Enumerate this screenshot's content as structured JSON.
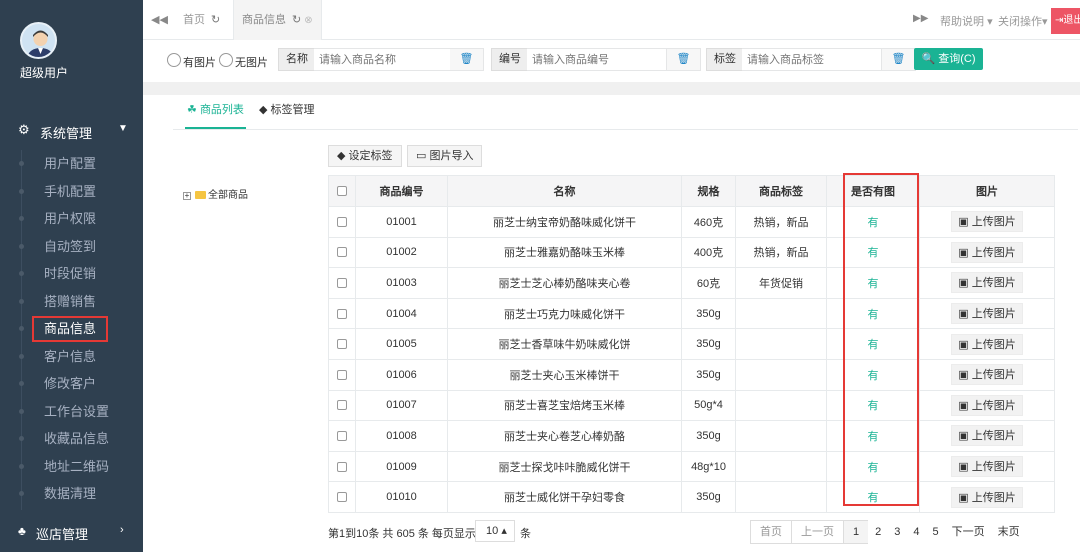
{
  "sidebar": {
    "user_name": "超级用户",
    "menu_title": "系统管理",
    "items": [
      {
        "label": "用户配置"
      },
      {
        "label": "手机配置"
      },
      {
        "label": "用户权限"
      },
      {
        "label": "自动签到"
      },
      {
        "label": "时段促销"
      },
      {
        "label": "搭赠销售"
      },
      {
        "label": "商品信息"
      },
      {
        "label": "客户信息"
      },
      {
        "label": "修改客户"
      },
      {
        "label": "工作台设置"
      },
      {
        "label": "收藏品信息"
      },
      {
        "label": "地址二维码"
      },
      {
        "label": "数据清理"
      }
    ],
    "active_item": "商品信息",
    "shop_menu": "巡店管理"
  },
  "tabs": {
    "home": "首页",
    "goods": "商品信息",
    "help": "帮助说明",
    "close_ops": "关闭操作",
    "logout": "退出"
  },
  "filters": {
    "with_pic": "有图片",
    "without_pic": "无图片",
    "name_label": "名称",
    "name_placeholder": "请输入商品名称",
    "code_label": "编号",
    "code_placeholder": "请输入商品编号",
    "tag_label": "标签",
    "tag_placeholder": "请输入商品标签",
    "query_button": "查询(C)"
  },
  "content_tabs": {
    "list": "商品列表",
    "tags": "标签管理"
  },
  "toolbar": {
    "set_tag": "设定标签",
    "import_pic": "图片导入"
  },
  "tree": {
    "root": "全部商品"
  },
  "table": {
    "columns": [
      "商品编号",
      "名称",
      "规格",
      "商品标签",
      "是否有图",
      "图片"
    ],
    "upload_label": "上传图片",
    "rows": [
      {
        "code": "01001",
        "name": "丽芝士纳宝帝奶酪味威化饼干",
        "spec": "460克",
        "tag": "热销，新品",
        "has_pic": "有"
      },
      {
        "code": "01002",
        "name": "丽芝士雅嘉奶酪味玉米棒",
        "spec": "400克",
        "tag": "热销，新品",
        "has_pic": "有"
      },
      {
        "code": "01003",
        "name": "丽芝士芝心棒奶酪味夹心卷",
        "spec": "60克",
        "tag": "年货促销",
        "has_pic": "有"
      },
      {
        "code": "01004",
        "name": "丽芝士巧克力味威化饼干",
        "spec": "350g",
        "tag": "",
        "has_pic": "有"
      },
      {
        "code": "01005",
        "name": "丽芝士香草味牛奶味威化饼",
        "spec": "350g",
        "tag": "",
        "has_pic": "有"
      },
      {
        "code": "01006",
        "name": "丽芝士夹心玉米棒饼干",
        "spec": "350g",
        "tag": "",
        "has_pic": "有"
      },
      {
        "code": "01007",
        "name": "丽芝士喜芝宝焙烤玉米棒",
        "spec": "50g*4",
        "tag": "",
        "has_pic": "有"
      },
      {
        "code": "01008",
        "name": "丽芝士夹心卷芝心棒奶酪",
        "spec": "350g",
        "tag": "",
        "has_pic": "有"
      },
      {
        "code": "01009",
        "name": "丽芝士探戈咔咔脆威化饼干",
        "spec": "48g*10",
        "tag": "",
        "has_pic": "有"
      },
      {
        "code": "01010",
        "name": "丽芝士威化饼干孕妇零食",
        "spec": "350g",
        "tag": "",
        "has_pic": "有"
      }
    ]
  },
  "pagination": {
    "summary": "第1到10条 共 605 条 每页显示",
    "page_size": "10",
    "unit": "条",
    "first": "首页",
    "prev": "上一页",
    "pages": [
      "1",
      "2",
      "3",
      "4",
      "5"
    ],
    "current": "1",
    "next": "下一页",
    "last": "末页"
  },
  "colors": {
    "sidebar_bg": "#2f4050",
    "accent_green": "#1ab394",
    "highlight_red": "#e53935",
    "logout_red": "#ed5565"
  }
}
